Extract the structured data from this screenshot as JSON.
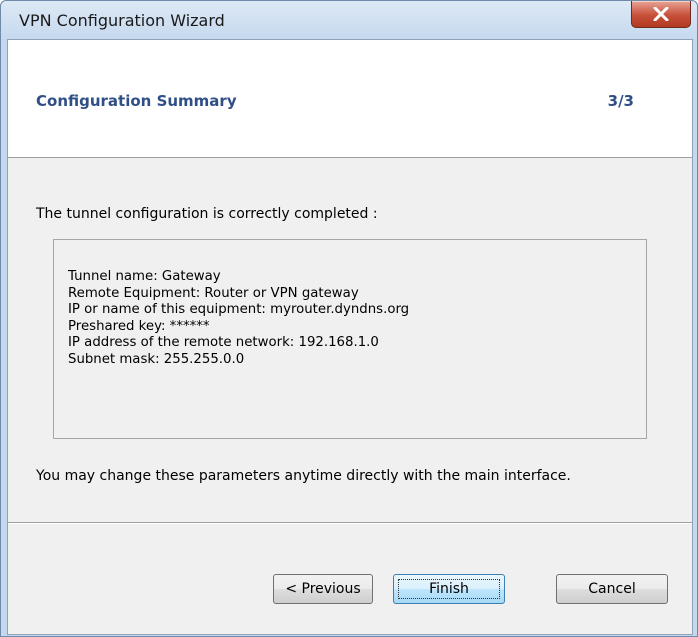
{
  "window": {
    "title": "VPN Configuration Wizard"
  },
  "header": {
    "title": "Configuration Summary",
    "step": "3/3"
  },
  "intro_text": "The tunnel configuration is correctly completed :",
  "summary": {
    "lines": [
      "Tunnel name: Gateway",
      "Remote Equipment: Router or VPN gateway",
      "IP or name of this equipment: myrouter.dyndns.org",
      "Preshared key: ******",
      "IP address of the remote network: 192.168.1.0",
      "Subnet mask: 255.255.0.0"
    ]
  },
  "note_text": "You may change these parameters anytime directly with the main interface.",
  "buttons": {
    "previous": "< Previous",
    "finish": "Finish",
    "cancel": "Cancel"
  },
  "icons": {
    "close": "close-icon"
  }
}
